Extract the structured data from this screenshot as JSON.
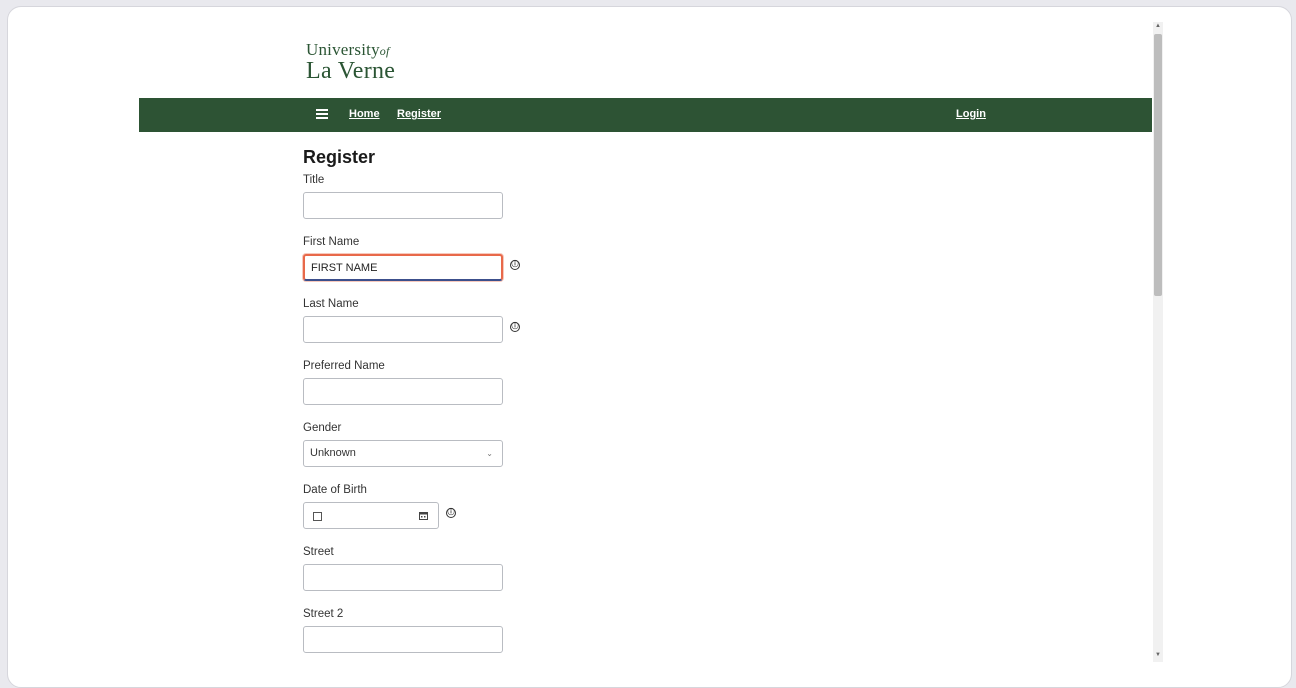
{
  "logo": {
    "line1": "University",
    "of": "of",
    "line2": "La Verne"
  },
  "nav": {
    "home": "Home",
    "register": "Register",
    "login": "Login"
  },
  "page": {
    "title": "Register"
  },
  "form": {
    "title_label": "Title",
    "first_name_label": "First Name",
    "first_name_value": "FIRST NAME",
    "last_name_label": "Last Name",
    "preferred_name_label": "Preferred Name",
    "gender_label": "Gender",
    "gender_value": "Unknown",
    "dob_label": "Date of Birth",
    "street_label": "Street",
    "street2_label": "Street 2"
  },
  "icons": {
    "info": "ⓘ",
    "chevron": "⌄"
  },
  "colors": {
    "brand_green": "#2d5334",
    "focus_border": "#e8694a"
  }
}
